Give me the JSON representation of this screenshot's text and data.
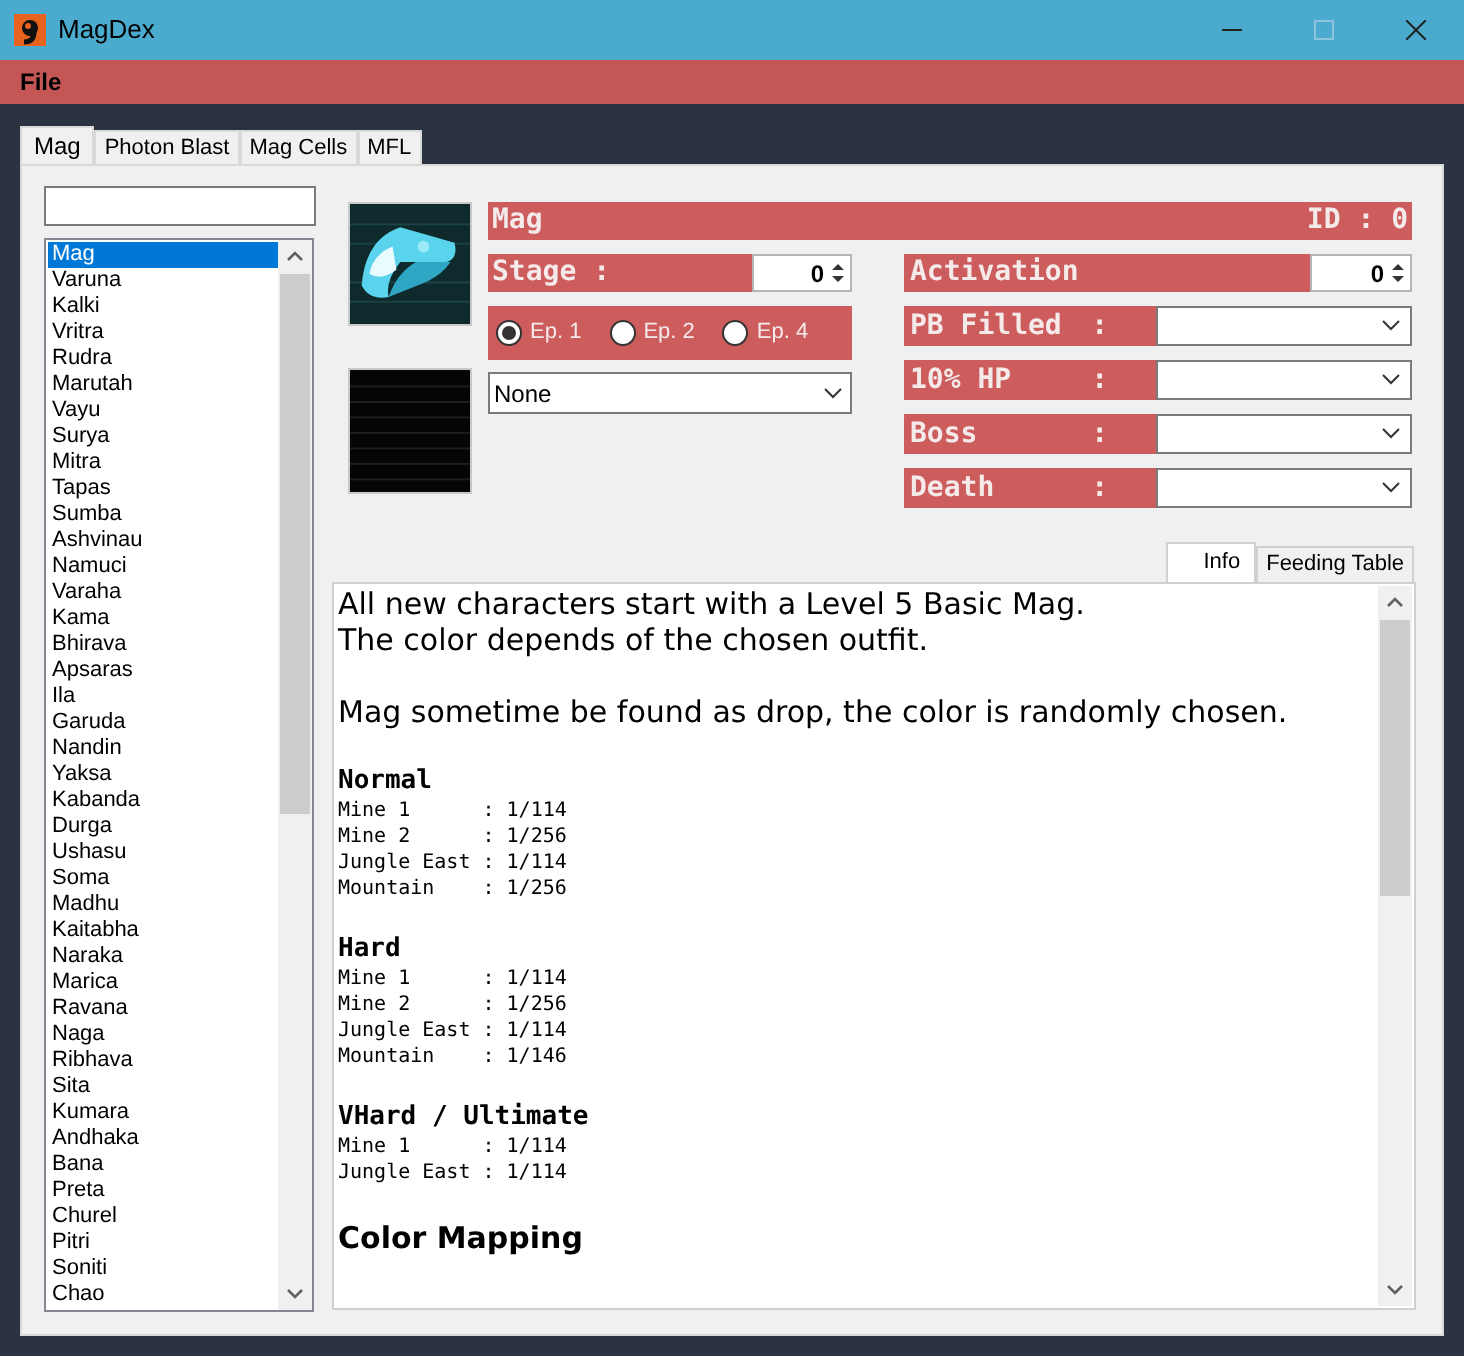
{
  "window": {
    "title": "MagDex"
  },
  "menu": [
    "File"
  ],
  "tabs": [
    {
      "label": "Mag",
      "selected": true
    },
    {
      "label": "Photon Blast",
      "selected": false
    },
    {
      "label": "Mag Cells",
      "selected": false
    },
    {
      "label": "MFL",
      "selected": false
    }
  ],
  "mag_list": {
    "items": [
      {
        "label": "Mag",
        "selected": true
      },
      {
        "label": "Varuna",
        "selected": false
      },
      {
        "label": "Kalki",
        "selected": false
      },
      {
        "label": "Vritra",
        "selected": false
      },
      {
        "label": "Rudra",
        "selected": false
      },
      {
        "label": "Marutah",
        "selected": false
      },
      {
        "label": "Vayu",
        "selected": false
      },
      {
        "label": "Surya",
        "selected": false
      },
      {
        "label": "Mitra",
        "selected": false
      },
      {
        "label": "Tapas",
        "selected": false
      },
      {
        "label": "Sumba",
        "selected": false
      },
      {
        "label": "Ashvinau",
        "selected": false
      },
      {
        "label": "Namuci",
        "selected": false
      },
      {
        "label": "Varaha",
        "selected": false
      },
      {
        "label": "Kama",
        "selected": false
      },
      {
        "label": "Bhirava",
        "selected": false
      },
      {
        "label": "Apsaras",
        "selected": false
      },
      {
        "label": "Ila",
        "selected": false
      },
      {
        "label": "Garuda",
        "selected": false
      },
      {
        "label": "Nandin",
        "selected": false
      },
      {
        "label": "Yaksa",
        "selected": false
      },
      {
        "label": "Kabanda",
        "selected": false
      },
      {
        "label": "Durga",
        "selected": false
      },
      {
        "label": "Ushasu",
        "selected": false
      },
      {
        "label": "Soma",
        "selected": false
      },
      {
        "label": "Madhu",
        "selected": false
      },
      {
        "label": "Kaitabha",
        "selected": false
      },
      {
        "label": "Naraka",
        "selected": false
      },
      {
        "label": "Marica",
        "selected": false
      },
      {
        "label": "Ravana",
        "selected": false
      },
      {
        "label": "Naga",
        "selected": false
      },
      {
        "label": "Ribhava",
        "selected": false
      },
      {
        "label": "Sita",
        "selected": false
      },
      {
        "label": "Kumara",
        "selected": false
      },
      {
        "label": "Andhaka",
        "selected": false
      },
      {
        "label": "Bana",
        "selected": false
      },
      {
        "label": "Preta",
        "selected": false
      },
      {
        "label": "Churel",
        "selected": false
      },
      {
        "label": "Pitri",
        "selected": false
      },
      {
        "label": "Soniti",
        "selected": false
      },
      {
        "label": "Chao",
        "selected": false
      }
    ]
  },
  "details": {
    "name": "Mag",
    "id": "ID : 0",
    "stage_label": "Stage :",
    "stage_value": "0",
    "episodes": [
      {
        "label": "Ep. 1",
        "selected": true
      },
      {
        "label": "Ep. 2",
        "selected": false
      },
      {
        "label": "Ep. 4",
        "selected": false
      }
    ],
    "color_dropdown": "None",
    "activation_label": "Activation",
    "activation_value": "0",
    "triggers": [
      {
        "label": "PB Filled",
        "colon": ":"
      },
      {
        "label": "10% HP",
        "colon": ":"
      },
      {
        "label": "Boss",
        "colon": ":"
      },
      {
        "label": "Death",
        "colon": ":"
      }
    ]
  },
  "info_tabs": [
    {
      "label": "Info",
      "selected": true
    },
    {
      "label": "Feeding Table",
      "selected": false
    }
  ],
  "info": [
    {
      "kind": "paragraph",
      "lines": [
        "All new characters start with a Level 5 Basic Mag.",
        "The color depends of the chosen outfit."
      ]
    },
    {
      "kind": "paragraph",
      "lines": [
        "Mag sometime be found as drop, the color is randomly chosen."
      ]
    },
    {
      "kind": "section",
      "title": "Normal",
      "lines": [
        "Mine 1      : 1/114",
        "Mine 2      : 1/256",
        "Jungle East : 1/114",
        "Mountain    : 1/256"
      ]
    },
    {
      "kind": "section",
      "title": "Hard",
      "lines": [
        "Mine 1      : 1/114",
        "Mine 2      : 1/256",
        "Jungle East : 1/114",
        "Mountain    : 1/146"
      ]
    },
    {
      "kind": "section",
      "title": "VHard / Ultimate",
      "lines": [
        "Mine 1      : 1/114",
        "Jungle East : 1/114"
      ]
    },
    {
      "kind": "title",
      "title": "Color Mapping"
    }
  ]
}
